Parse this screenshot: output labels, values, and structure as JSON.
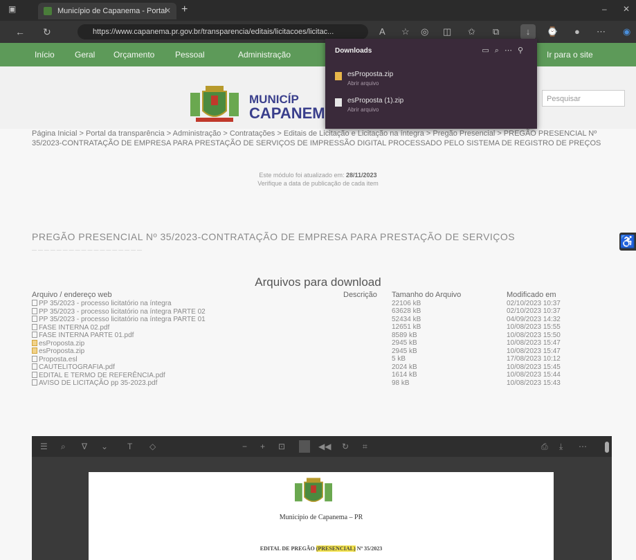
{
  "browser": {
    "tab_title": "Município de Capanema - Portal",
    "url": "https://www.capanema.pr.gov.br/transparencia/editais/licitacoes/licitac..."
  },
  "site_menu": [
    "Início",
    "Geral",
    "Orçamento",
    "Pessoal",
    "Administração",
    "Ir para o site"
  ],
  "header": {
    "municipio_line1": "MUNICÍP",
    "municipio_line2": "CAPANEM",
    "search_placeholder": "Pesquisar"
  },
  "downloads_panel": {
    "title": "Downloads",
    "items": [
      {
        "name": "esProposta.zip",
        "status": "Abrir arquivo"
      },
      {
        "name": "esProposta (1).zip",
        "status": "Abrir arquivo"
      }
    ]
  },
  "breadcrumb": "Página Inicial > Portal da transparência > Administração > Contratações > Editais de Licitação e Licitação na íntegra > Pregão Presencial > PREGÃO PRESENCIAL Nº 35/2023-CONTRATAÇÃO DE EMPRESA PARA PRESTAÇÃO DE SERVIÇOS DE IMPRESSÃO DIGITAL PROCESSADO PELO SISTEMA DE REGISTRO DE PREÇOS",
  "updated": {
    "prefix": "Este módulo foi atualizado em:",
    "date": "28/11/2023",
    "note": "Verifique a data de publicação de cada item"
  },
  "page_title": "PREGÃO PRESENCIAL Nº 35/2023-CONTRATAÇÃO DE EMPRESA PARA PRESTAÇÃO DE SERVIÇOS",
  "downloads_section": {
    "title": "Arquivos para download",
    "columns": [
      "Arquivo / endereço web",
      "Descrição",
      "Tamanho do Arquivo",
      "Modificado em"
    ],
    "files": [
      {
        "name": "PP 35/2023 - processo licitatório na íntegra",
        "desc": "",
        "size": "22106 kB",
        "modified": "02/10/2023 10:37",
        "icon": "file-icon"
      },
      {
        "name": "PP 35/2023 - processo licitatório na íntegra PARTE 02",
        "desc": "",
        "size": "63628 kB",
        "modified": "02/10/2023 10:37",
        "icon": "file-icon"
      },
      {
        "name": "PP 35/2023 - processo licitatório na íntegra PARTE 01",
        "desc": "",
        "size": "52434 kB",
        "modified": "04/09/2023 14:32",
        "icon": "file-icon"
      },
      {
        "name": "FASE INTERNA 02.pdf",
        "desc": "",
        "size": "12651 kB",
        "modified": "10/08/2023 15:55",
        "icon": "file-icon"
      },
      {
        "name": "FASE INTERNA PARTE 01.pdf",
        "desc": "",
        "size": "8589 kB",
        "modified": "10/08/2023 15:50",
        "icon": "file-icon"
      },
      {
        "name": "esProposta.zip",
        "desc": "",
        "size": "2945 kB",
        "modified": "10/08/2023 15:47",
        "icon": "zip-icon"
      },
      {
        "name": "esProposta.zip",
        "desc": "",
        "size": "2945 kB",
        "modified": "10/08/2023 15:47",
        "icon": "zip-icon"
      },
      {
        "name": "Proposta.esl",
        "desc": "",
        "size": "5 kB",
        "modified": "17/08/2023 10:12",
        "icon": "file-icon"
      },
      {
        "name": "CAUTELITOGRAFIA.pdf",
        "desc": "",
        "size": "2024 kB",
        "modified": "10/08/2023 15:45",
        "icon": "file-icon"
      },
      {
        "name": "EDITAL E TERMO DE REFERÊNCIA.pdf",
        "desc": "",
        "size": "1614 kB",
        "modified": "10/08/2023 15:44",
        "icon": "file-icon"
      },
      {
        "name": "AVISO DE LICITAÇÃO pp 35-2023.pdf",
        "desc": "",
        "size": "98 kB",
        "modified": "10/08/2023 15:43",
        "icon": "file-icon"
      }
    ]
  },
  "pdf_viewer": {
    "municipio": "Município de Capanema – PR",
    "edital_prefix": "EDITAL DE PREGÃO",
    "edital_highlight": "(PRESENCIAL)",
    "edital_suffix": "Nº 35/2023"
  },
  "colors": {
    "menu_green": "#5d9a59",
    "brand_blue": "#3a3f8c",
    "download_panel": "#3a2a3a",
    "highlight": "#f3e24a"
  }
}
